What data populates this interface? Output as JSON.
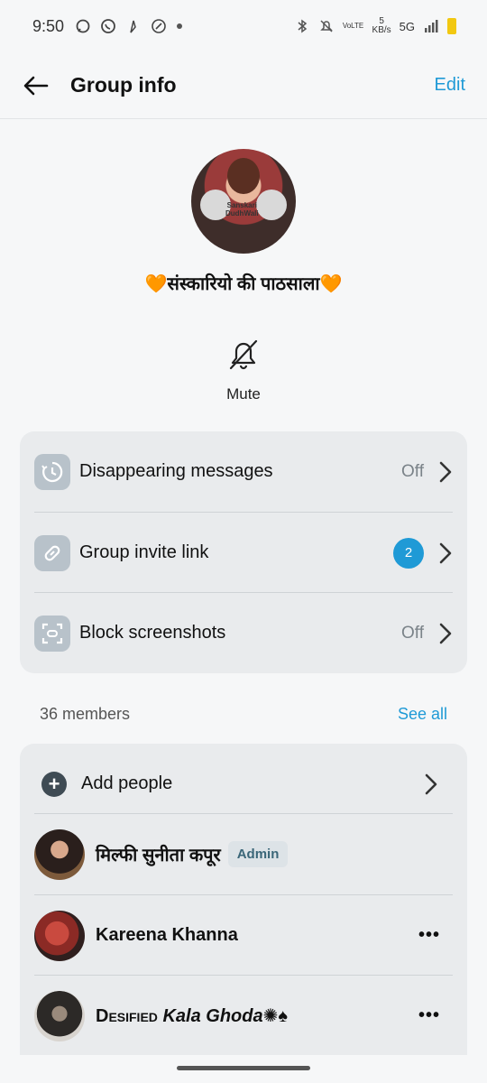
{
  "status_bar": {
    "time": "9:50",
    "net_speed_value": "5",
    "net_speed_unit": "KB/s",
    "volte": "VoLTE",
    "network": "5G"
  },
  "header": {
    "title": "Group info",
    "edit_label": "Edit"
  },
  "group": {
    "name": "🧡संस्कारियो की पाठसाला🧡",
    "avatar_watermark_1": "Sanskari",
    "avatar_watermark_2": "DudhWali",
    "mute_label": "Mute"
  },
  "settings": {
    "disappearing": {
      "label": "Disappearing messages",
      "value": "Off"
    },
    "invite": {
      "label": "Group invite link",
      "badge": "2"
    },
    "screenshots": {
      "label": "Block screenshots",
      "value": "Off"
    }
  },
  "members": {
    "count_label": "36 members",
    "see_all_label": "See all",
    "add_people_label": "Add people",
    "list": [
      {
        "name": "मिल्फी सुनीता कपूर",
        "role": "Admin"
      },
      {
        "name": "Kareena Khanna",
        "more": "•••"
      },
      {
        "name_part1": "Desified",
        "name_part2": "Kala Ghoda",
        "name_suffix": "✺♠",
        "more": "•••"
      }
    ]
  },
  "colors": {
    "accent": "#1f9ad6",
    "background": "#f6f7f8",
    "card": "#e9ebed",
    "heart": "#f28b1e"
  }
}
